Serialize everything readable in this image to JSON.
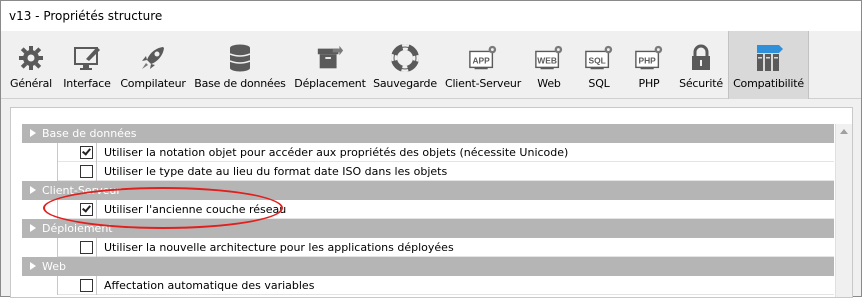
{
  "window": {
    "title": "v13 - Propriétés structure"
  },
  "toolbar": {
    "items": [
      {
        "label": "Général",
        "icon": "gear-icon"
      },
      {
        "label": "Interface",
        "icon": "monitor-pen-icon"
      },
      {
        "label": "Compilateur",
        "icon": "rocket-icon"
      },
      {
        "label": "Base de données",
        "icon": "database-icon"
      },
      {
        "label": "Déplacement",
        "icon": "box-arrow-icon"
      },
      {
        "label": "Sauvegarde",
        "icon": "lifebuoy-icon"
      },
      {
        "label": "Client-Serveur",
        "icon": "app-gear-icon",
        "badge": "APP"
      },
      {
        "label": "Web",
        "icon": "web-gear-icon",
        "badge": "WEB"
      },
      {
        "label": "SQL",
        "icon": "sql-gear-icon",
        "badge": "SQL"
      },
      {
        "label": "PHP",
        "icon": "php-gear-icon",
        "badge": "PHP"
      },
      {
        "label": "Sécurité",
        "icon": "lock-icon"
      },
      {
        "label": "Compatibilité",
        "icon": "compatibility-icon"
      }
    ],
    "active_index": 11
  },
  "groups": [
    {
      "title": "Base de données",
      "options": [
        {
          "label": "Utiliser la notation objet pour accéder aux propriétés des objets (nécessite Unicode)",
          "checked": true
        },
        {
          "label": "Utiliser le type date au lieu du format date ISO dans les objets",
          "checked": false
        }
      ]
    },
    {
      "title": "Client-Serveur",
      "options": [
        {
          "label": "Utiliser l'ancienne couche réseau",
          "checked": true
        }
      ]
    },
    {
      "title": "Déploiement",
      "options": [
        {
          "label": "Utiliser la nouvelle architecture pour les applications déployées",
          "checked": false
        }
      ]
    },
    {
      "title": "Web",
      "options": [
        {
          "label": "Affectation automatique des variables",
          "checked": false
        }
      ]
    }
  ],
  "colors": {
    "group_header_bg": "#b5b5b5",
    "highlight_oval": "#e0201e",
    "active_tab_bg": "#d9d9d9",
    "compat_icon_blue": "#2f8fd8"
  }
}
